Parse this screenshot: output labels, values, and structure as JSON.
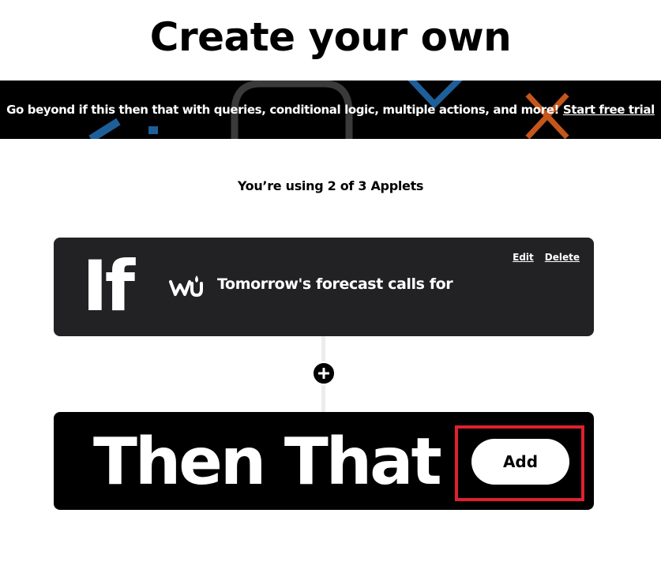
{
  "header": {
    "title": "Create your own"
  },
  "promo": {
    "text": "Go beyond if this then that with queries, conditional logic, multiple actions, and more!",
    "link_label": "Start free trial",
    "decor_colors": [
      "#1e5f9a",
      "#3a3a3a",
      "#1e5f9a",
      "#c4561c"
    ]
  },
  "usage": {
    "text": "You’re using 2 of 3 Applets"
  },
  "if_card": {
    "label": "If",
    "service_icon": "weather-underground-icon",
    "trigger_text": "Tomorrow's forecast calls for",
    "edit_label": "Edit",
    "delete_label": "Delete",
    "background_color": "#222225"
  },
  "add_step": {
    "icon": "plus-icon"
  },
  "that_card": {
    "label": "Then That",
    "add_label": "Add",
    "highlight_color": "#e0202e"
  }
}
